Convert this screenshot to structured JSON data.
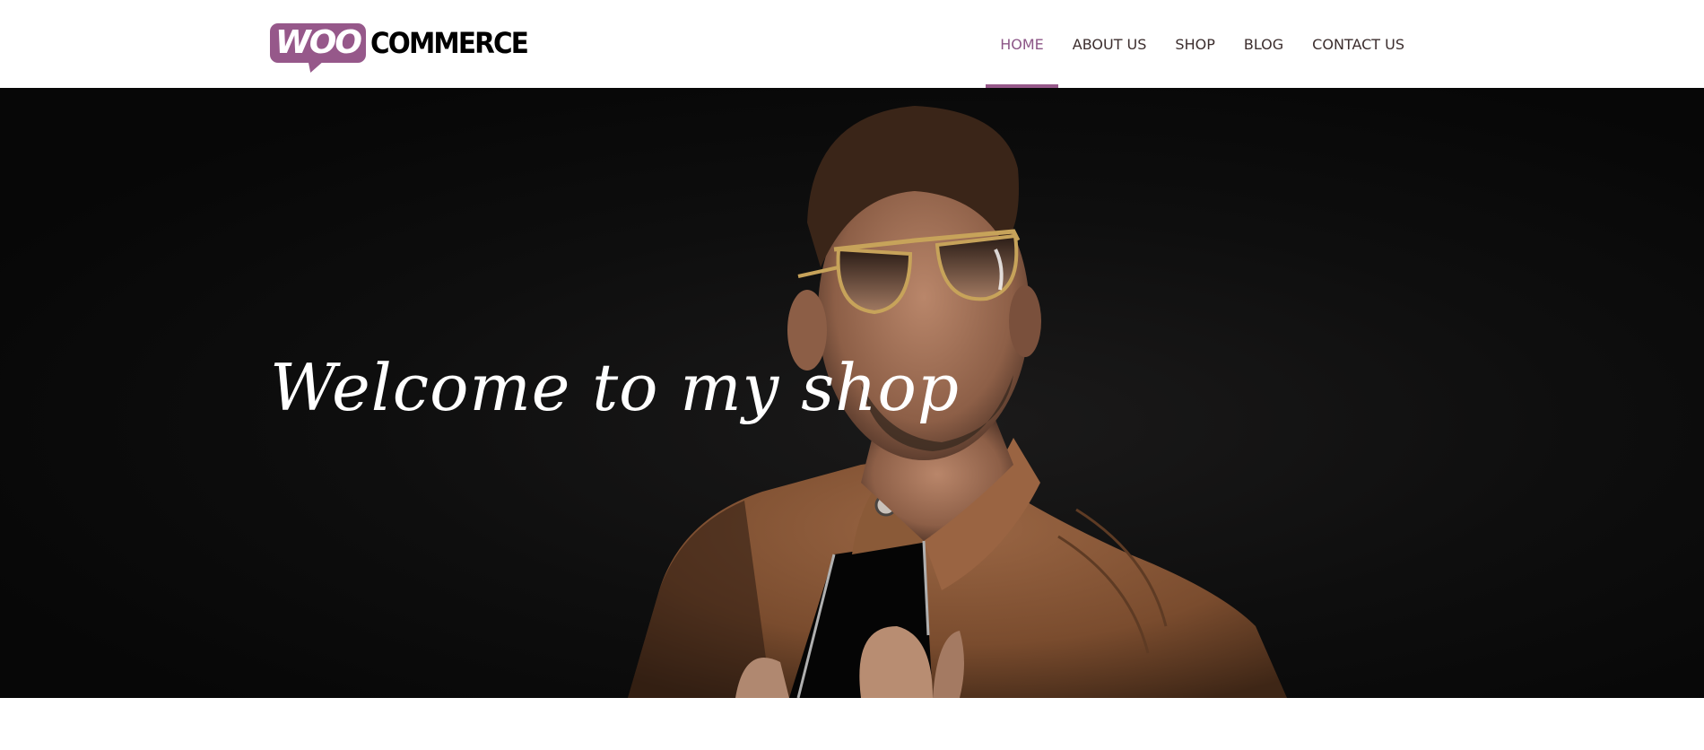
{
  "brand": {
    "logo_woo": "WOO",
    "logo_commerce": "COMMERCE"
  },
  "nav": {
    "items": [
      {
        "label": "HOME",
        "active": true
      },
      {
        "label": "ABOUT US",
        "active": false
      },
      {
        "label": "SHOP",
        "active": false
      },
      {
        "label": "BLOG",
        "active": false
      },
      {
        "label": "CONTACT US",
        "active": false
      }
    ]
  },
  "hero": {
    "title": "Welcome to my shop"
  },
  "colors": {
    "accent": "#96588a",
    "nav_text": "#3c2e2e",
    "hero_bg": "#0a0a0a",
    "jacket": "#8a5a38"
  }
}
